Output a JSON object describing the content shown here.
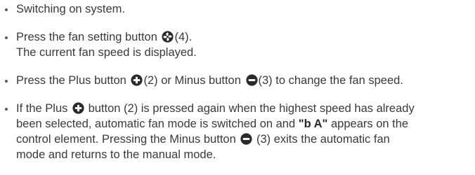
{
  "items": [
    {
      "line1": "Switching on system."
    },
    {
      "line1_before": "Press the fan setting button",
      "line1_after": "(4).",
      "line2": "The current fan speed is displayed.",
      "icon": "fan-icon"
    },
    {
      "before": "Press the Plus button",
      "mid": "(2) or Minus button",
      "after": "(3) to change the fan speed.",
      "icon_plus": "plus-circle-icon",
      "icon_minus": "minus-circle-icon"
    },
    {
      "l1_before": "If the Plus",
      "l1_after": "button (2) is pressed again when the highest speed has already",
      "l2_before": "been selected, automatic fan mode is switched on and",
      "l2_bold": "\"b A\"",
      "l2_after": "appears on the",
      "l3_before": "control element. Pressing the Minus button",
      "l3_after": "(3) exits the automatic fan",
      "l4": "mode and returns to the manual mode.",
      "icon_plus": "plus-circle-icon",
      "icon_minus": "minus-circle-icon"
    }
  ],
  "colors": {
    "text": "#3a3a3a",
    "icon": "#2a2a2a"
  }
}
